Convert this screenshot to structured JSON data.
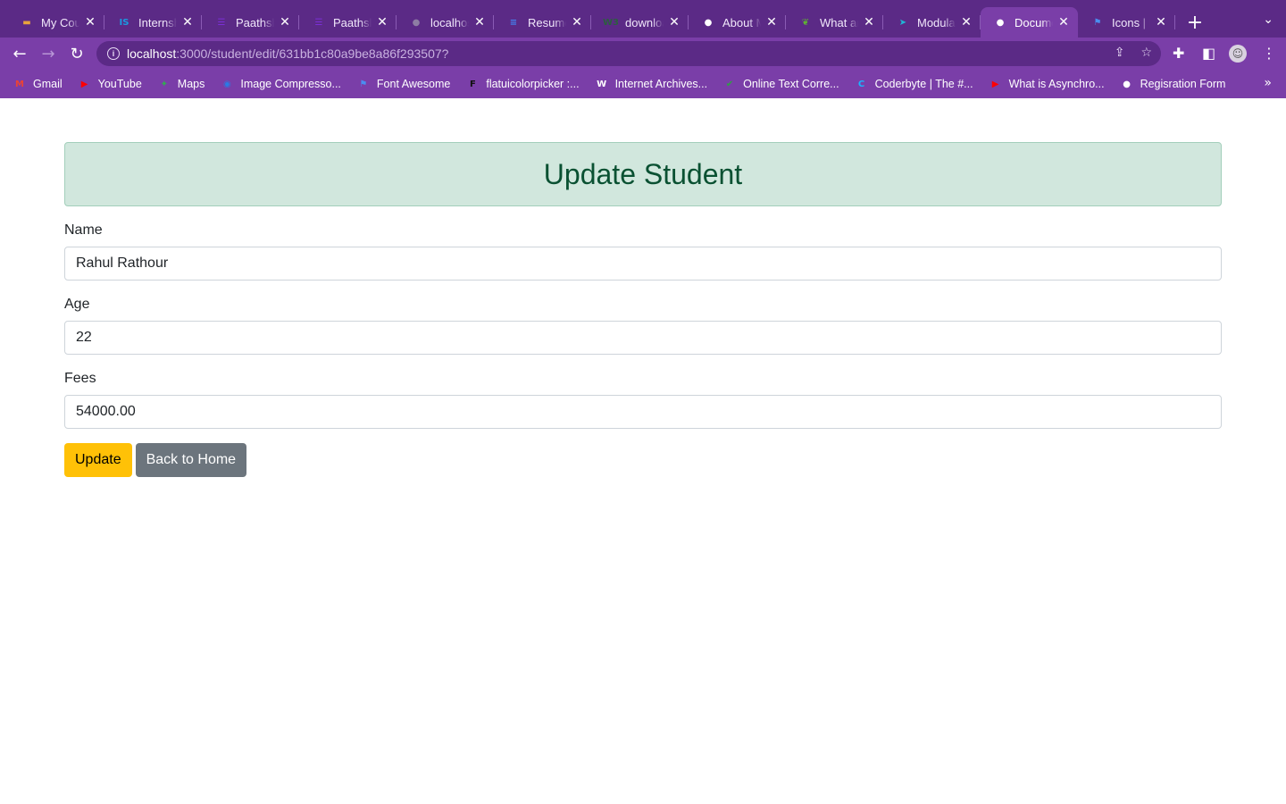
{
  "browser": {
    "tabs": [
      {
        "title": "My Courses",
        "icon": "course-icon",
        "color": "#e8a33c",
        "glyph": "▬"
      },
      {
        "title": "Internshala",
        "icon": "internshala-icon",
        "color": "#1a9ae0",
        "glyph": "IS"
      },
      {
        "title": "Paathshala",
        "icon": "list-icon",
        "color": "#7b2fd6",
        "glyph": "☰"
      },
      {
        "title": "Paathshala",
        "icon": "list-icon",
        "color": "#7b2fd6",
        "glyph": "☰"
      },
      {
        "title": "localhost",
        "icon": "globe-icon",
        "color": "#8e7ca4",
        "glyph": "●"
      },
      {
        "title": "Resume",
        "icon": "docs-icon",
        "color": "#4285f4",
        "glyph": "≡"
      },
      {
        "title": "download",
        "icon": "w3schools-icon",
        "color": "#2c5e3f",
        "glyph": "W3"
      },
      {
        "title": "About Me",
        "icon": "globe-icon",
        "color": "#ffffff",
        "glyph": "●"
      },
      {
        "title": "What are",
        "icon": "leaf-icon",
        "color": "#5fb233",
        "glyph": "❦"
      },
      {
        "title": "Modular",
        "icon": "modular-icon",
        "color": "#1fb6d6",
        "glyph": "➤"
      },
      {
        "title": "Document",
        "icon": "globe-icon",
        "color": "#ffffff",
        "glyph": "●",
        "active": true
      },
      {
        "title": "Icons | Font Awesome",
        "icon": "flag-icon",
        "color": "#4a8ef0",
        "glyph": "⚑"
      }
    ],
    "url_host": "localhost",
    "url_path": ":3000/student/edit/631bb1c80a9be8a86f293507?",
    "bookmarks": [
      {
        "label": "Gmail",
        "icon": "gmail-icon",
        "color": "#ea4335",
        "glyph": "M"
      },
      {
        "label": "YouTube",
        "icon": "youtube-icon",
        "color": "#ff0000",
        "glyph": "▶"
      },
      {
        "label": "Maps",
        "icon": "maps-icon",
        "color": "#34a853",
        "glyph": "✦"
      },
      {
        "label": "Image Compresso...",
        "icon": "compress-icon",
        "color": "#2a7be4",
        "glyph": "◉"
      },
      {
        "label": "Font Awesome",
        "icon": "flag-icon",
        "color": "#4a8ef0",
        "glyph": "⚑"
      },
      {
        "label": "flatuicolorpicker :...",
        "icon": "flatui-icon",
        "color": "#111111",
        "glyph": "F"
      },
      {
        "label": "Internet Archives...",
        "icon": "wordpress-icon",
        "color": "#ffffff",
        "glyph": "W"
      },
      {
        "label": "Online Text Corre...",
        "icon": "check-icon",
        "color": "#2ea043",
        "glyph": "✔"
      },
      {
        "label": "Coderbyte | The #...",
        "icon": "coderbyte-icon",
        "color": "#19b5fe",
        "glyph": "C"
      },
      {
        "label": "What is Asynchro...",
        "icon": "youtube-icon",
        "color": "#ff0000",
        "glyph": "▶"
      },
      {
        "label": "Regisration Form",
        "icon": "globe-icon",
        "color": "#ffffff",
        "glyph": "●"
      }
    ]
  },
  "page": {
    "heading": "Update Student",
    "fields": [
      {
        "label": "Name",
        "value": "Rahul Rathour"
      },
      {
        "label": "Age",
        "value": "22"
      },
      {
        "label": "Fees",
        "value": "54000.00"
      }
    ],
    "update_label": "Update",
    "back_label": "Back to Home"
  },
  "colors": {
    "chrome_dark": "#5b2a86",
    "chrome": "#7a3ea8",
    "alert_bg": "#d1e7dd",
    "alert_text": "#0a5132",
    "btn_warning": "#ffc107",
    "btn_secondary": "#6c757d"
  }
}
